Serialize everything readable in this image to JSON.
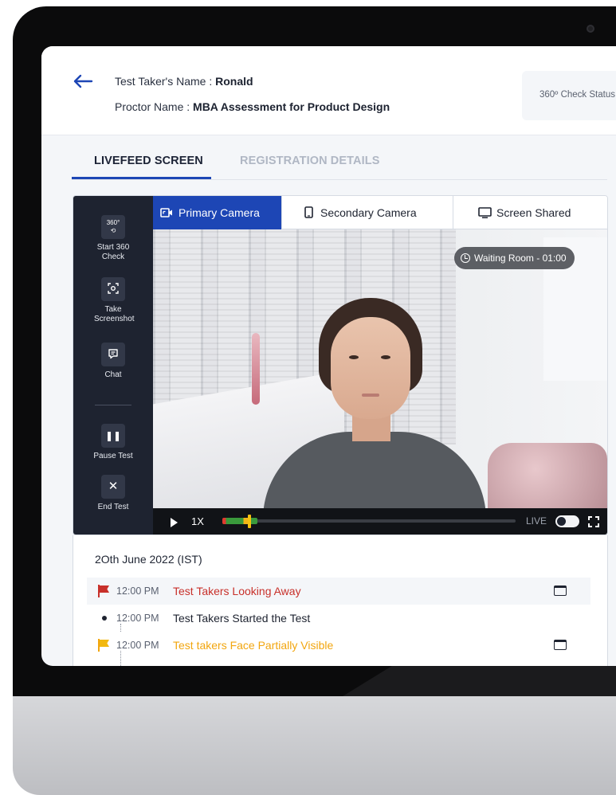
{
  "header": {
    "test_taker_label": "Test Taker's Name :",
    "test_taker_name": "Ronald",
    "proctor_label": "Proctor Name :",
    "proctor_name": "MBA Assessment for Product Design",
    "status_label": "360º Check Status"
  },
  "tabs": [
    {
      "label": "LIVEFEED SCREEN",
      "active": true
    },
    {
      "label": "REGISTRATION DETAILS",
      "active": false
    }
  ],
  "tools": [
    {
      "icon": "360",
      "label": "Start 360 Check"
    },
    {
      "icon": "screenshot",
      "label": "Take Screenshot"
    },
    {
      "icon": "chat",
      "label": "Chat"
    },
    {
      "icon": "pause",
      "label": "Pause Test"
    },
    {
      "icon": "close",
      "label": "End Test"
    }
  ],
  "camera_tabs": [
    {
      "icon": "video-camera-icon",
      "label": "Primary Camera",
      "active": true
    },
    {
      "icon": "phone-icon",
      "label": "Secondary Camera",
      "active": false
    },
    {
      "icon": "monitor-icon",
      "label": "Screen Shared",
      "active": false
    }
  ],
  "video": {
    "waiting_badge": "Waiting Room - 01:00",
    "speed": "1X",
    "live_label": "LIVE",
    "progress_fraction": 0.12
  },
  "events": {
    "date": "2Oth June 2022 (IST)",
    "items": [
      {
        "time": "12:00 PM",
        "text": "Test Takers Looking Away",
        "kind": "red-flag",
        "color": "#c8302a",
        "has_doc": true
      },
      {
        "time": "12:00 PM",
        "text": "Test Takers Started the Test",
        "kind": "dot",
        "color": "#1e2330",
        "has_doc": false
      },
      {
        "time": "12:00 PM",
        "text": "Test takers Face Partially Visible",
        "kind": "yellow-flag",
        "color": "#f2a60f",
        "has_doc": true
      }
    ]
  },
  "colors": {
    "accent": "#1d46b5",
    "sidebar": "#1e2330",
    "alert_red": "#c8302a",
    "alert_yellow": "#f2a60f"
  }
}
